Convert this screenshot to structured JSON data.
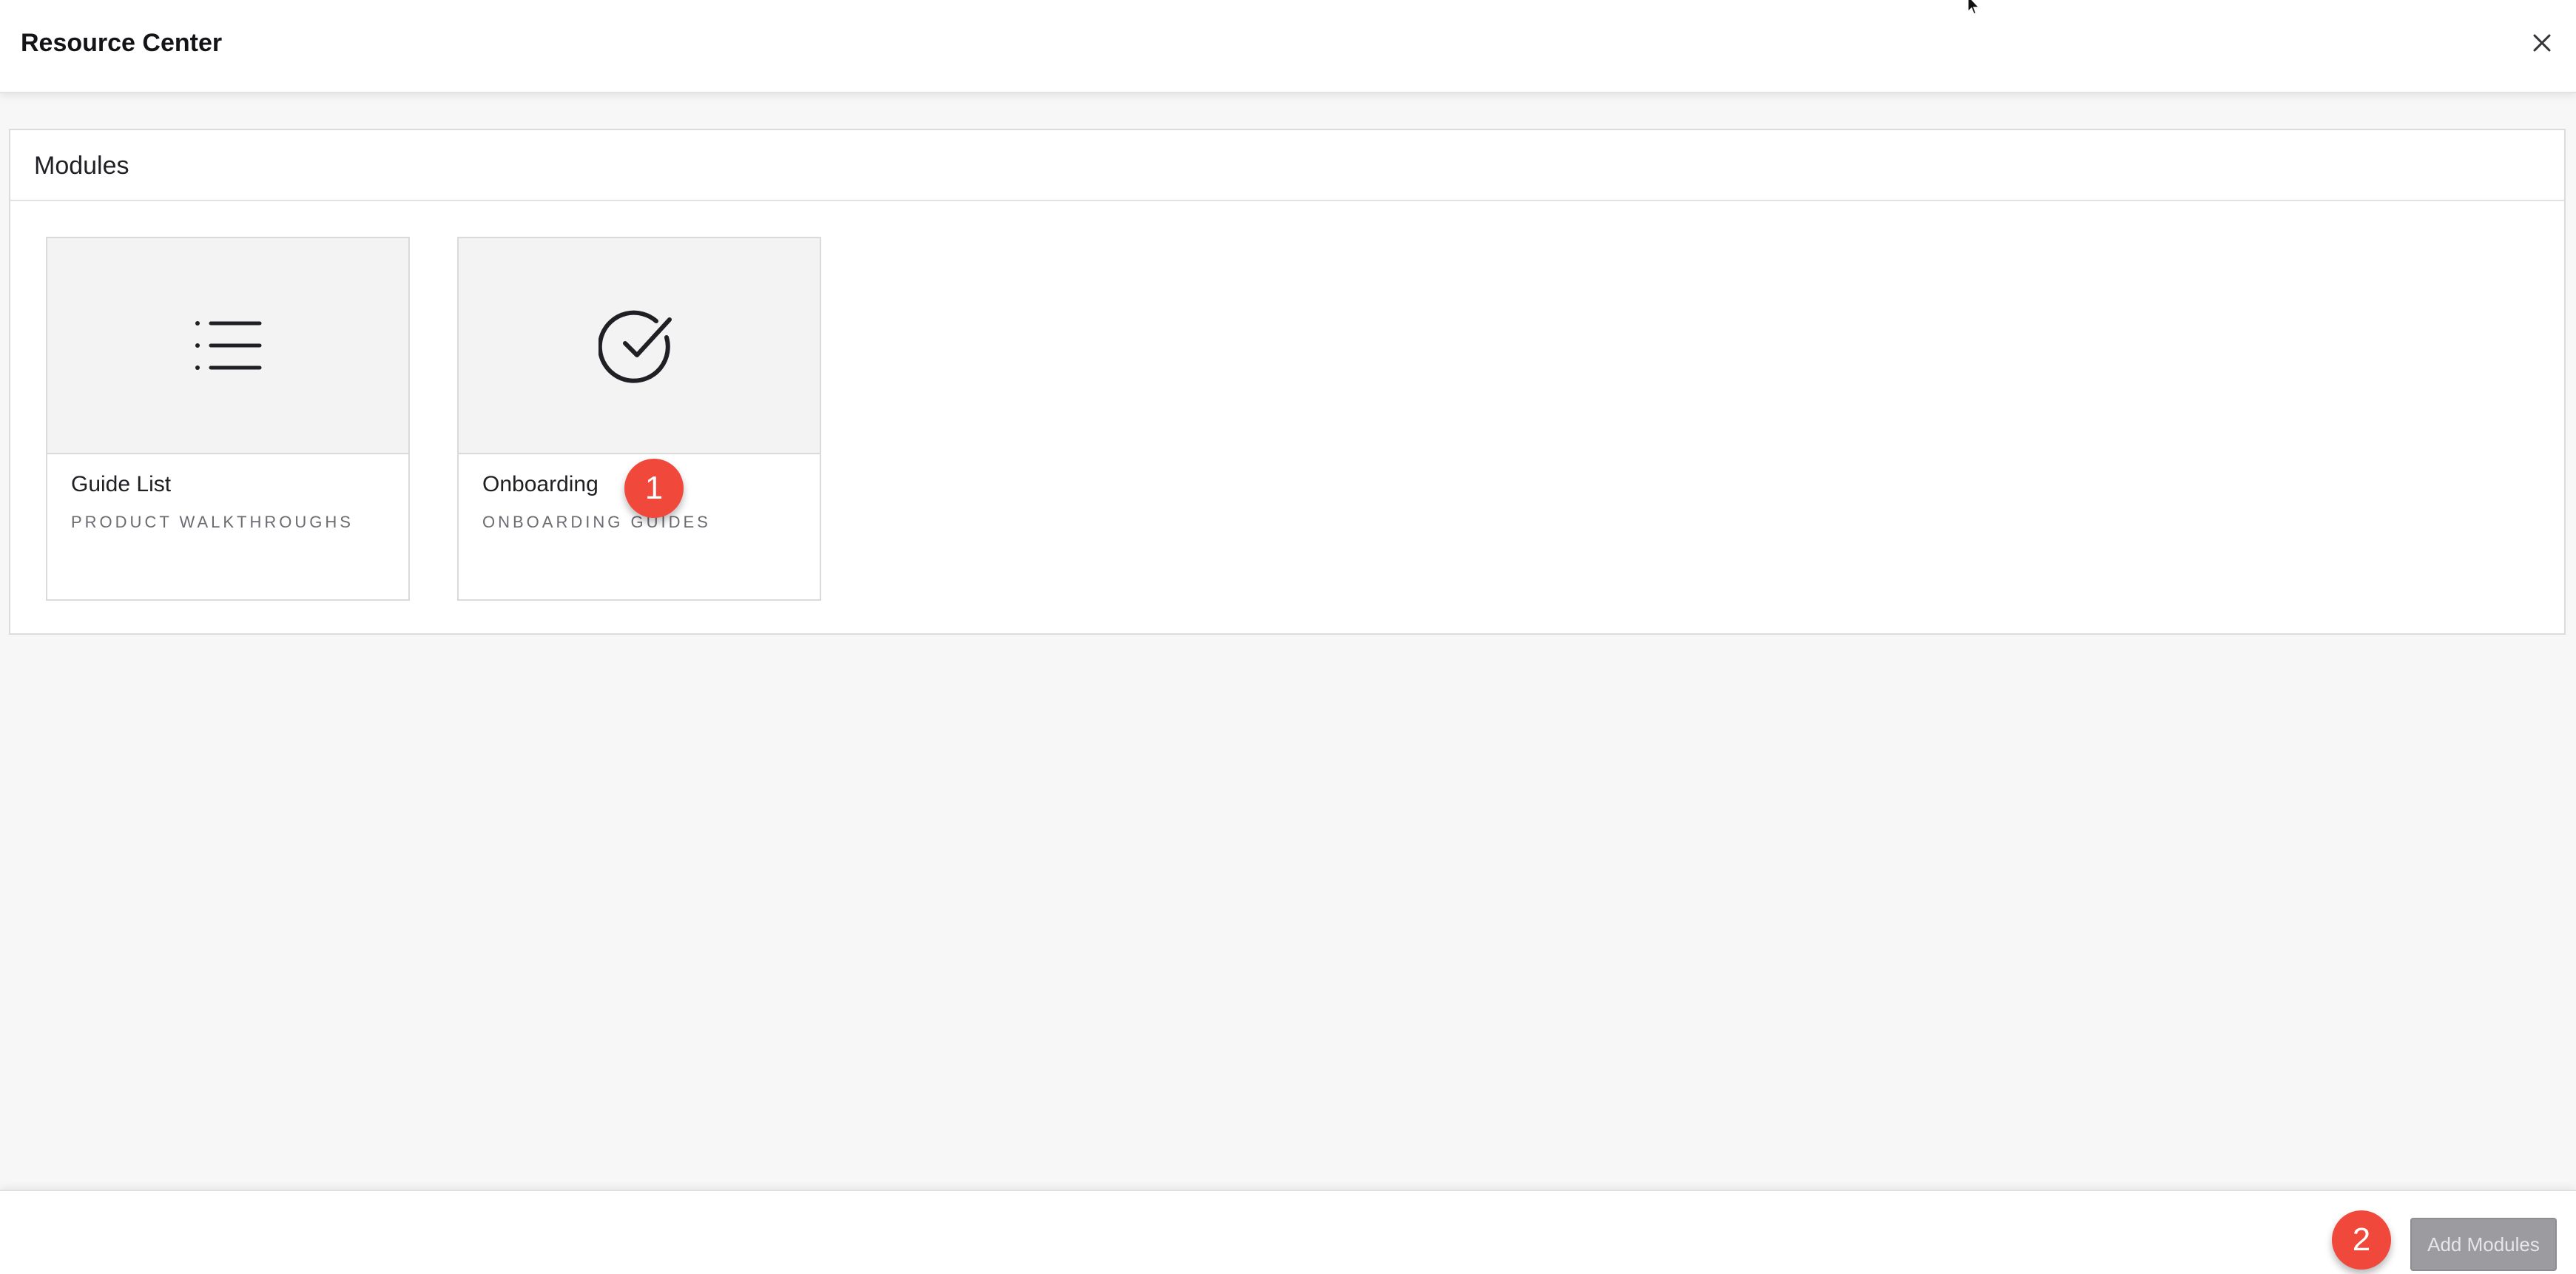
{
  "header": {
    "title": "Resource Center",
    "close_icon": "close-icon"
  },
  "modules": {
    "title": "Modules",
    "cards": [
      {
        "title": "Guide List",
        "subtitle": "PRODUCT WALKTHROUGHS",
        "icon": "list-icon"
      },
      {
        "title": "Onboarding",
        "subtitle": "ONBOARDING GUIDES",
        "icon": "check-circle-icon"
      }
    ]
  },
  "annotations": {
    "badge_1": "1",
    "badge_2": "2",
    "badge_color": "#f0483b"
  },
  "footer": {
    "add_modules_label": "Add Modules",
    "add_modules_disabled": true
  },
  "colors": {
    "background": "#f7f7f7",
    "panel": "#ffffff",
    "text_primary": "#1f1f24",
    "text_secondary": "#6b6b72",
    "button_disabled": "#9b9ba0"
  }
}
